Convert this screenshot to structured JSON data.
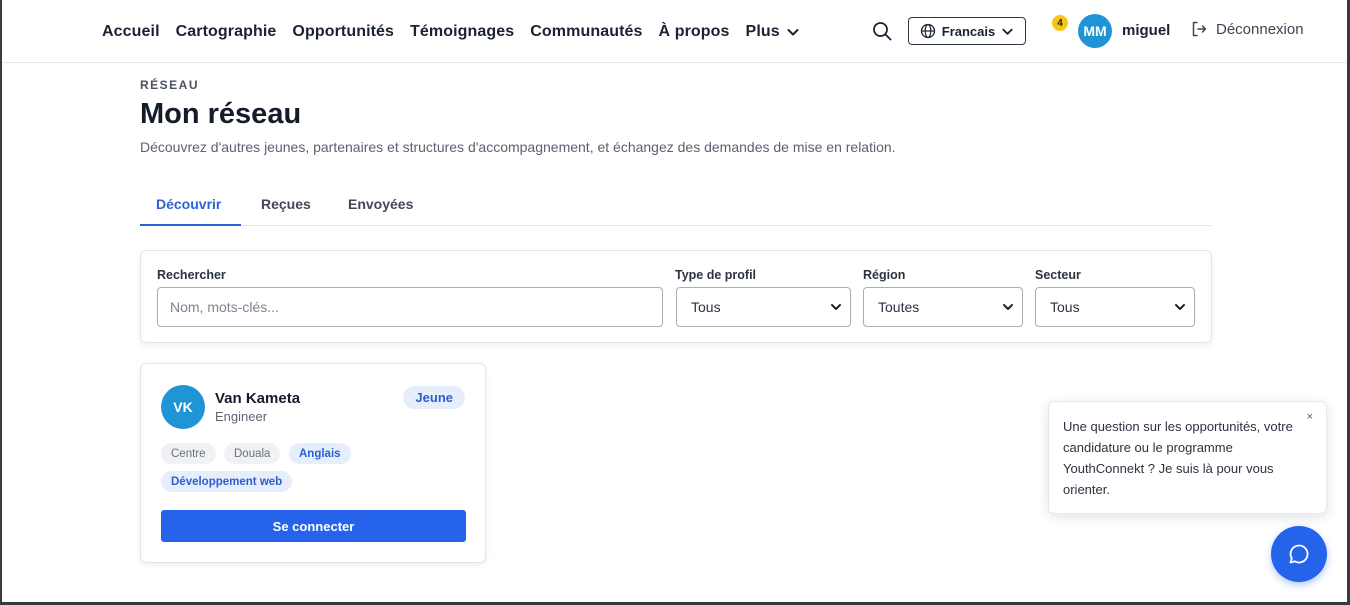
{
  "nav": {
    "items": [
      "Accueil",
      "Cartographie",
      "Opportunités",
      "Témoignages",
      "Communautés",
      "À propos"
    ],
    "more_label": "Plus"
  },
  "header": {
    "language": "Francais",
    "notification_count": "4",
    "avatar_initials": "MM",
    "username": "miguel",
    "logout_label": "Déconnexion"
  },
  "page": {
    "eyebrow": "RÉSEAU",
    "title": "Mon réseau",
    "subtitle": "Découvrez d'autres jeunes, partenaires et structures d'accompagnement, et échangez des demandes de mise en relation."
  },
  "tabs": [
    "Découvrir",
    "Reçues",
    "Envoyées"
  ],
  "filters": {
    "search_label": "Rechercher",
    "search_placeholder": "Nom, mots-clés...",
    "profile_type_label": "Type de profil",
    "profile_type_value": "Tous",
    "region_label": "Région",
    "region_value": "Toutes",
    "sector_label": "Secteur",
    "sector_value": "Tous"
  },
  "profiles": [
    {
      "initials": "VK",
      "name": "Van Kameta",
      "role": "Engineer",
      "type": "Jeune",
      "tags": [
        "Centre",
        "Douala",
        "Anglais",
        "Développement web"
      ],
      "connect_label": "Se connecter"
    }
  ],
  "chat": {
    "message": "Une question sur les opportunités, votre candidature ou le programme YouthConnekt ? Je suis là pour vous orienter.",
    "close_label": "×"
  },
  "colors": {
    "accent": "#2563eb",
    "avatar": "#1f95d6",
    "badge": "#f5c518"
  }
}
